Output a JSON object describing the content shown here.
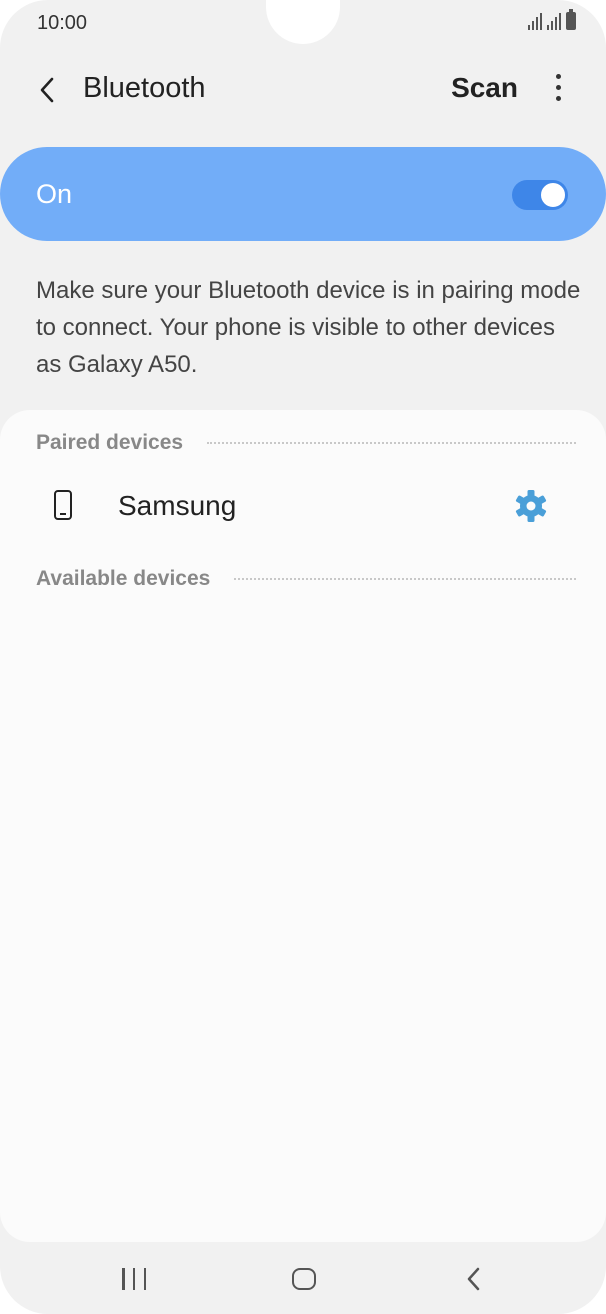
{
  "status_bar": {
    "time": "10:00"
  },
  "app_bar": {
    "title": "Bluetooth",
    "scan_label": "Scan"
  },
  "bluetooth_toggle": {
    "label": "On",
    "state": true,
    "colors": {
      "bar": "#72adf8",
      "switch": "#3e86e8"
    }
  },
  "description": "Make sure your Bluetooth device is in pairing mode to connect. Your phone is visible to other devices as Galaxy A50.",
  "paired_devices": {
    "header": "Paired devices",
    "items": [
      {
        "name": "Samsung",
        "icon": "smartphone-icon",
        "action_icon": "settings-gear-icon"
      }
    ]
  },
  "available_devices": {
    "header": "Available devices"
  },
  "nav_bar": {
    "recent": "recent-apps-icon",
    "home": "home-icon",
    "back": "back-icon"
  },
  "accent_color": "#4a9fd8"
}
